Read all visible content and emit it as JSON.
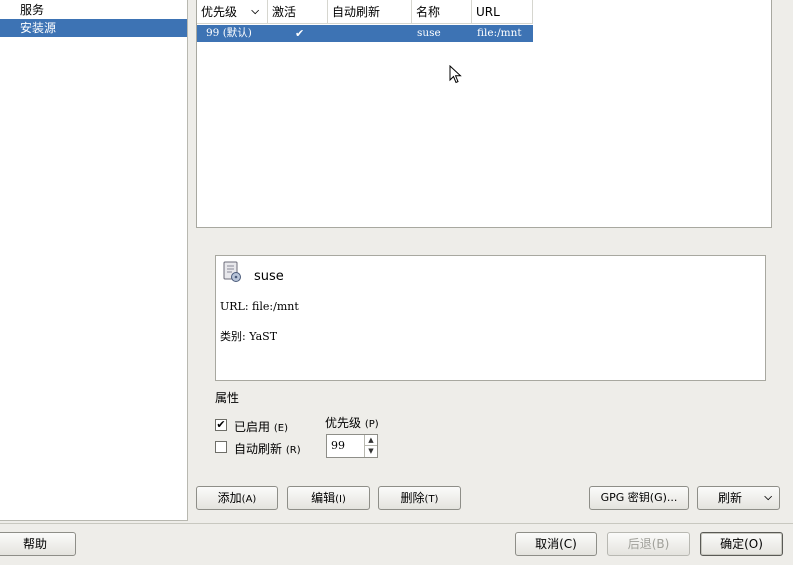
{
  "sidebar": {
    "items": [
      {
        "label": "服务"
      },
      {
        "label": "安装源"
      }
    ]
  },
  "table": {
    "columns": [
      "优先级",
      "激活",
      "自动刷新",
      "名称",
      "URL"
    ],
    "rows": [
      {
        "priority": "99 (默认)",
        "active": "✔",
        "autorefresh": "",
        "name": "suse",
        "url": "file:/mnt"
      }
    ]
  },
  "details": {
    "name": "suse",
    "url_line": "URL: file:/mnt",
    "type_line": "类别: YaST"
  },
  "properties": {
    "title": "属性",
    "enabled_label": "已启用",
    "enabled_key": "(E)",
    "enabled_checked": true,
    "autorefresh_label": "自动刷新",
    "autorefresh_key": "(R)",
    "autorefresh_checked": false,
    "priority_label": "优先级",
    "priority_key": "(P)",
    "priority_value": "99"
  },
  "actions": {
    "add": "添加",
    "add_key": "(A)",
    "edit": "编辑",
    "edit_key": "(I)",
    "delete": "删除",
    "delete_key": "(T)",
    "gpg": "GPG 密钥(G)...",
    "refresh": "刷新"
  },
  "footer": {
    "help": "帮助",
    "cancel": "取消(C)",
    "back": "后退(B)",
    "ok": "确定(O)"
  },
  "colors": {
    "selection": "#3d73b4",
    "background": "#eeede9"
  }
}
